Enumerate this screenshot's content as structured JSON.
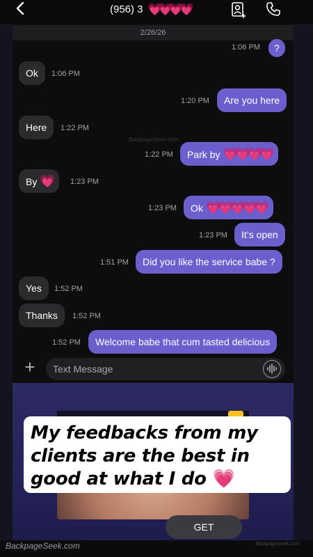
{
  "header": {
    "back_glyph": "<",
    "contact_name": "(956) 3",
    "contact_hearts": "💗💗💗💗",
    "icons": [
      "chevron-left-icon",
      "contact-add-icon",
      "phone-icon"
    ]
  },
  "chat": {
    "date": "2/26/26",
    "watermark": "BackpageSeek.com",
    "messages": [
      {
        "dir": "out",
        "text": "?",
        "time": "1:06 PM"
      },
      {
        "dir": "in",
        "text": "Ok",
        "time": "1:06 PM"
      },
      {
        "dir": "out",
        "text": "Are you here",
        "time": "1:20 PM"
      },
      {
        "dir": "in",
        "text": "Here",
        "time": "1:22 PM"
      },
      {
        "dir": "out",
        "text": "Park by",
        "time": "1:22 PM",
        "hearts": "💗💗💗💗"
      },
      {
        "dir": "in",
        "text": "By",
        "time": "1:23 PM",
        "hearts": "💗"
      },
      {
        "dir": "out",
        "text": "Ok",
        "time": "1:23 PM",
        "hearts": "💗💗💗💗💗"
      },
      {
        "dir": "out",
        "text": "It’s open",
        "time": "1:23 PM"
      },
      {
        "dir": "out",
        "text": "Did you like the service babe ?",
        "time": "1:51 PM"
      },
      {
        "dir": "in",
        "text": "Yes",
        "time": "1:52 PM"
      },
      {
        "dir": "in",
        "text": "Thanks",
        "time": "1:52 PM"
      },
      {
        "dir": "out",
        "text": "Welcome babe that cum tasted delicious",
        "time": "1:52 PM"
      }
    ]
  },
  "composer": {
    "plus_glyph": "+",
    "placeholder": "Text Message"
  },
  "ad": {
    "get_label": "GET"
  },
  "overlay": {
    "caption": "My feedbacks from my clients are the best in good at what I do",
    "heart": "💗"
  },
  "footer": {
    "watermark": "BackpageSeek.com",
    "watermark_right": "BackpageSeek.com"
  },
  "colors": {
    "outgoing_bubble": "#6a5fcd",
    "incoming_bubble": "#2b2b2e",
    "background": "#0d0d0e",
    "ad_background": "#2d2a63"
  }
}
